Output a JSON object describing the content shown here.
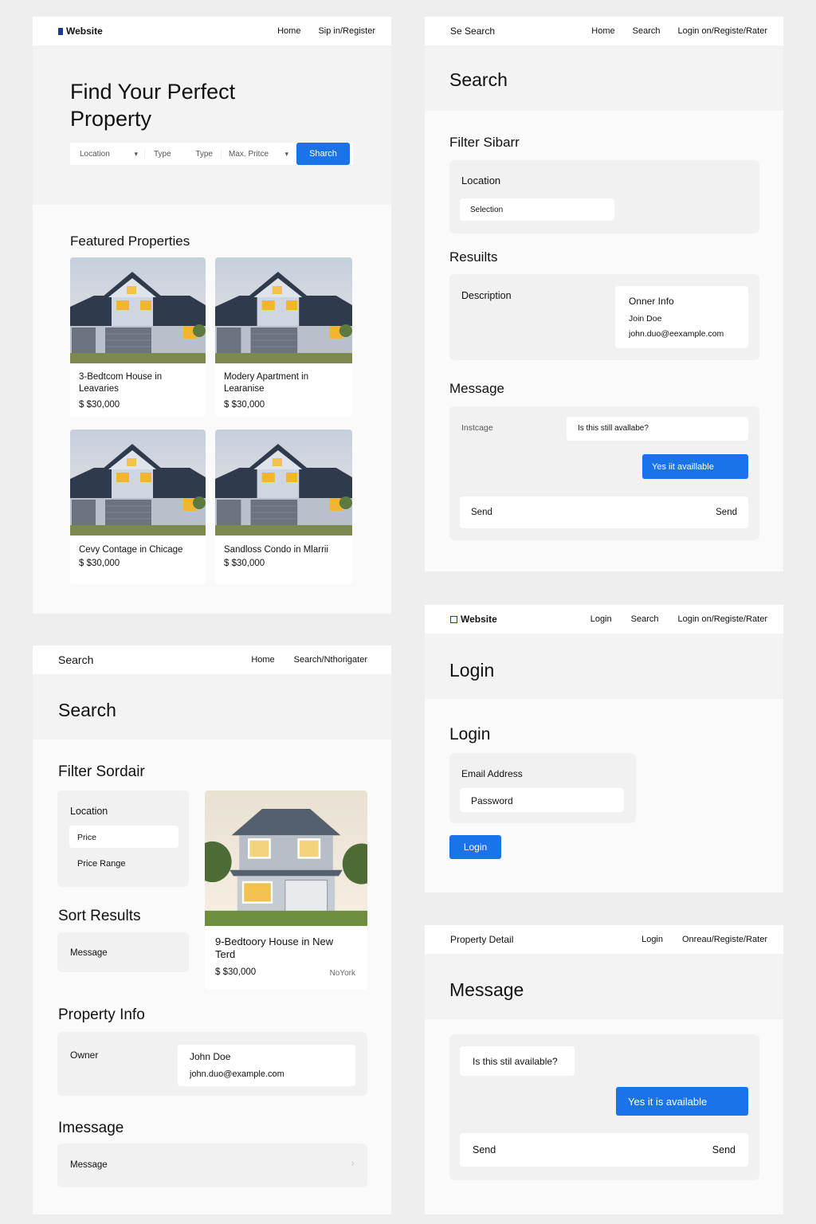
{
  "colors": {
    "accent": "#1a73e8",
    "panel": "#fafafa",
    "box": "#f1f1f1"
  },
  "p1": {
    "brand": "Website",
    "nav": [
      "Home",
      "Sip in/Register"
    ],
    "hero_title_l1": "Find Your Perfect",
    "hero_title_l2": "Property",
    "search": {
      "location": "Location",
      "type1": "Type",
      "type2": "Type",
      "max_price": "Max. Pritce",
      "button": "Sharch"
    },
    "featured_title": "Featured Properties",
    "cards": [
      {
        "title_l1": "3-Bedtcom House in",
        "title_l2": "Leavaries",
        "price": "$ $30,000"
      },
      {
        "title_l1": "Modery Apartment in",
        "title_l2": "Learanise",
        "price": "$ $30,000"
      },
      {
        "title_l1": "Cevy Contage in Chicage",
        "title_l2": "",
        "price": "$ $30,000"
      },
      {
        "title_l1": "Sandloss Condo in Mlarrii",
        "title_l2": "",
        "price": "$ $30,000"
      }
    ]
  },
  "p2": {
    "brand": "Se Search",
    "nav": [
      "Home",
      "Search",
      "Login on/Registe/Rater"
    ],
    "title": "Search",
    "filter_title": "Filter Sibarr",
    "location_label": "Location",
    "selection": "Selection",
    "results_title": "Resuilts",
    "description": "Description",
    "owner_title": "Onner Info",
    "owner_name": "Join Doe",
    "owner_email": "john.duo@eexample.com",
    "message_title": "Message",
    "message_label": "Instcage",
    "bubble_q": "Is this still avallabe?",
    "bubble_a": "Yes iit availlable",
    "send_left": "Send",
    "send_right": "Send"
  },
  "p3": {
    "brand": "Search",
    "nav": [
      "Home",
      "Search/Nthorigater"
    ],
    "title": "Search",
    "filter_title": "Filter Sordair",
    "location": "Location",
    "price": "Price",
    "price_range": "Price Range",
    "sort_title": "Sort Results",
    "sort_message": "Message",
    "card_title_l1": "9-Bedtoory House in New",
    "card_title_l2": "Terd",
    "card_price": "$ $30,000",
    "card_loc": "NoYork",
    "info_title": "Property Info",
    "owner_label": "Owner",
    "owner_name": "John Doe",
    "owner_email": "john.duo@example.com",
    "message_title": "Imessage",
    "message_label": "Message"
  },
  "p4": {
    "brand": "Website",
    "nav": [
      "Login",
      "Search",
      "Login on/Registe/Rater"
    ],
    "title": "Login",
    "form_title": "Login",
    "email": "Email Address",
    "password": "Password",
    "button": "Login"
  },
  "p5": {
    "brand": "Property Detail",
    "nav": [
      "Login",
      "Onreau/Registe/Rater"
    ],
    "title": "Message",
    "bubble_q": "Is this stil available?",
    "bubble_a": "Yes it is available",
    "send_left": "Send",
    "send_right": "Send"
  }
}
